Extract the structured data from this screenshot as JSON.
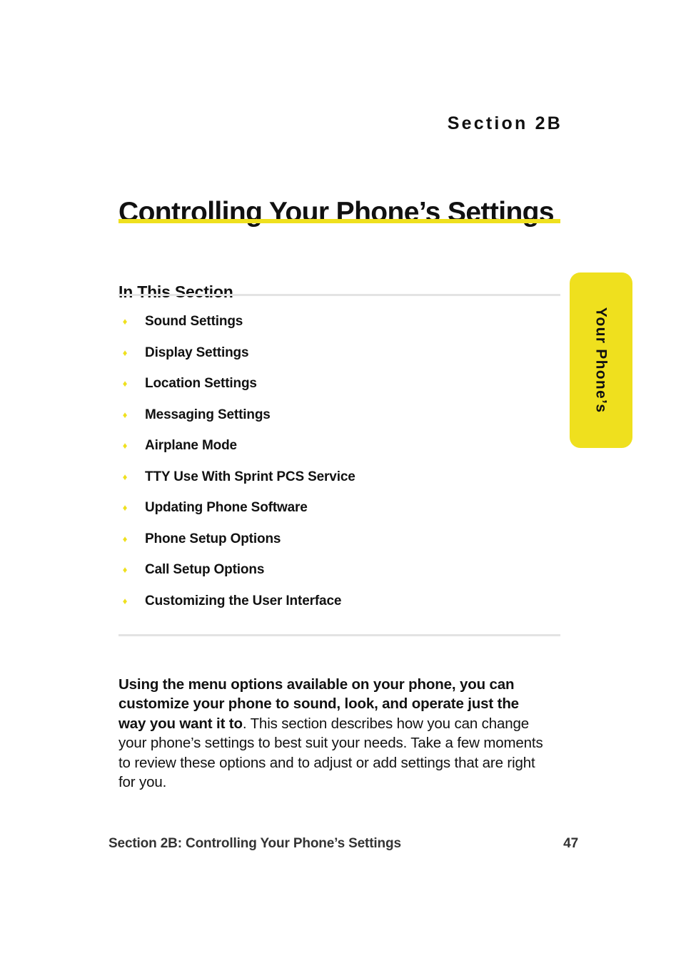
{
  "page": {
    "section_eyebrow": "Section 2B",
    "chapter_title": "Controlling Your Phone’s Settings"
  },
  "in_this_section": {
    "heading": "In This Section",
    "bullet_glyph": "♦",
    "items": [
      {
        "label": "Sound Settings"
      },
      {
        "label": "Display Settings"
      },
      {
        "label": "Location Settings"
      },
      {
        "label": "Messaging Settings"
      },
      {
        "label": "Airplane Mode"
      },
      {
        "label": "TTY Use With Sprint PCS Service"
      },
      {
        "label": "Updating Phone Software"
      },
      {
        "label": "Phone Setup Options"
      },
      {
        "label": "Call Setup Options"
      },
      {
        "label": "Customizing the User Interface"
      }
    ]
  },
  "intro": {
    "lead_bold": "Using the menu options available on your phone, you can customize your phone to sound, look, and operate just the way you want it to",
    "rest": ". This section describes how you can change your phone’s settings to best suit your needs. Take a few moments to review these options and to adjust or add settings that are right for you."
  },
  "side_tab": {
    "label": "Your Phone’s"
  },
  "footer": {
    "left": "Section 2B: Controlling Your Phone’s Settings",
    "page_number": "47"
  },
  "colors": {
    "accent_yellow": "#EFE01E",
    "rule_gray": "#E3E3E3",
    "text_black": "#111111",
    "footer_gray": "#333333"
  }
}
